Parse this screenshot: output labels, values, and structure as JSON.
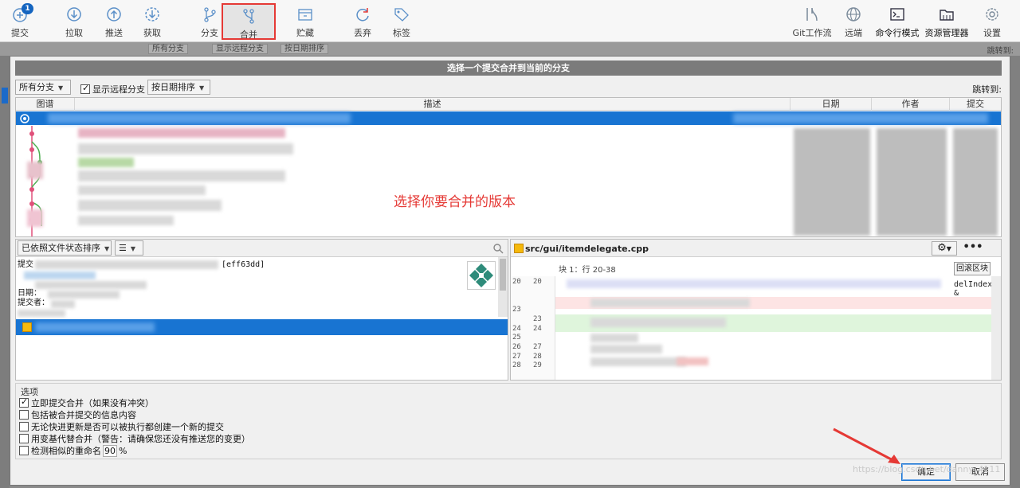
{
  "toolbar": {
    "commit": "提交",
    "commit_badge": "1",
    "pull": "拉取",
    "push": "推送",
    "fetch": "获取",
    "branch": "分支",
    "merge": "合并",
    "stash": "贮藏",
    "discard": "丢弃",
    "tag": "标签",
    "git_flow": "Git工作流",
    "remote": "远端",
    "terminal": "命令行模式",
    "explorer": "资源管理器",
    "settings": "设置"
  },
  "background": {
    "all_branches": "所有分支",
    "show_remote": "显示远程分支",
    "sort_date": "按日期排序",
    "jump_to": "跳转到:"
  },
  "dialog": {
    "title": "选择一个提交合并到当前的分支",
    "branch_filter": "所有分支",
    "show_remote_label": "显示远程分支",
    "show_remote_checked": true,
    "sort_order": "按日期排序",
    "jump_to": "跳转到:",
    "columns": {
      "graph": "图谱",
      "description": "描述",
      "date": "日期",
      "author": "作者",
      "commit": "提交"
    },
    "annotation": "选择你要合并的版本",
    "file_sort": "已依照文件状态排序",
    "commit_info": {
      "commit_label": "提交",
      "hash_suffix": "[eff63dd]",
      "date_label": "日期：",
      "committer_label": "提交者："
    },
    "diff": {
      "file": "src/gui/itemdelegate.cpp",
      "hunk": "块 1：行 20-38",
      "revert_hunk": "回滚区块",
      "model_text": "delIndex &",
      "old_lines": [
        "20",
        "",
        "",
        "23",
        "",
        "24",
        "25",
        "26",
        "27",
        "28"
      ],
      "new_lines": [
        "20",
        "",
        "",
        "",
        "23",
        "24",
        "",
        "27",
        "28",
        "29"
      ]
    },
    "options": {
      "title": "选项",
      "items": [
        {
          "label": "立即提交合并（如果没有冲突）",
          "checked": true
        },
        {
          "label": "包括被合并提交的信息内容",
          "checked": false
        },
        {
          "label": "无论快进更新是否可以被执行都创建一个新的提交",
          "checked": false
        },
        {
          "label": "用变基代替合并（警告：请确保您还没有推送您的变更）",
          "checked": false
        }
      ],
      "rename_label": "检测相似的重命名",
      "rename_checked": false,
      "rename_value": "90",
      "rename_unit": "%"
    },
    "ok": "确定",
    "cancel": "取消"
  },
  "watermark": "https://blog.csdn.net/danny_4111"
}
